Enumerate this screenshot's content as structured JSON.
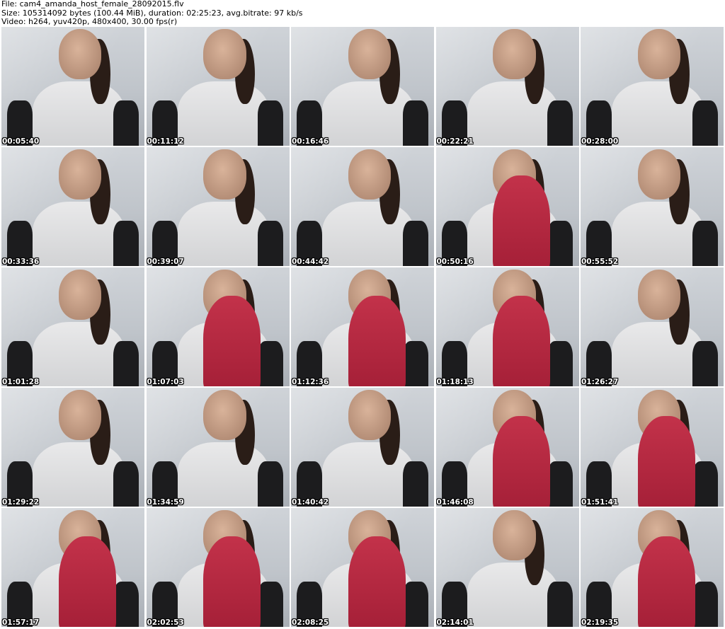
{
  "header": {
    "file_line": "File: cam4_amanda_host_female_28092015.flv",
    "size_line": "Size: 105314092 bytes (100.44 MiB), duration: 02:25:23, avg.bitrate: 97 kb/s",
    "video_line": "Video: h264, yuv420p, 480x400, 30.00 fps(r)"
  },
  "thumbnails": [
    {
      "timestamp": "00:05:40",
      "red": false
    },
    {
      "timestamp": "00:11:12",
      "red": false
    },
    {
      "timestamp": "00:16:46",
      "red": false
    },
    {
      "timestamp": "00:22:21",
      "red": false
    },
    {
      "timestamp": "00:28:00",
      "red": false
    },
    {
      "timestamp": "00:33:36",
      "red": false
    },
    {
      "timestamp": "00:39:07",
      "red": false
    },
    {
      "timestamp": "00:44:42",
      "red": false
    },
    {
      "timestamp": "00:50:16",
      "red": true
    },
    {
      "timestamp": "00:55:52",
      "red": false
    },
    {
      "timestamp": "01:01:28",
      "red": false
    },
    {
      "timestamp": "01:07:03",
      "red": true
    },
    {
      "timestamp": "01:12:36",
      "red": true
    },
    {
      "timestamp": "01:18:13",
      "red": true
    },
    {
      "timestamp": "01:26:27",
      "red": false
    },
    {
      "timestamp": "01:29:22",
      "red": false
    },
    {
      "timestamp": "01:34:59",
      "red": false
    },
    {
      "timestamp": "01:40:42",
      "red": false
    },
    {
      "timestamp": "01:46:08",
      "red": true
    },
    {
      "timestamp": "01:51:41",
      "red": true
    },
    {
      "timestamp": "01:57:17",
      "red": true
    },
    {
      "timestamp": "02:02:53",
      "red": true
    },
    {
      "timestamp": "02:08:25",
      "red": true
    },
    {
      "timestamp": "02:14:01",
      "red": false
    },
    {
      "timestamp": "02:19:35",
      "red": true
    }
  ]
}
